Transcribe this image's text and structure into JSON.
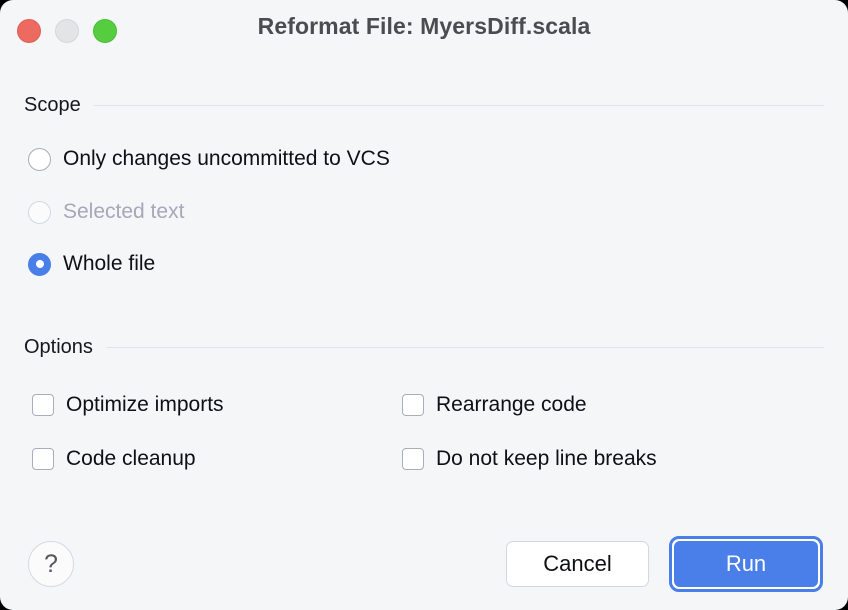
{
  "window": {
    "title": "Reformat File: MyersDiff.scala",
    "background_color": "#f5f6f8",
    "accent_color": "#4a7ee8",
    "traffic_lights": [
      {
        "name": "close",
        "color": "#ec6a5f"
      },
      {
        "name": "minimize",
        "color": "#e3e4e6"
      },
      {
        "name": "zoom",
        "color": "#56cc3f"
      }
    ]
  },
  "scope": {
    "heading": "Scope",
    "options": [
      {
        "label": "Only changes uncommitted to VCS",
        "selected": false,
        "disabled": false
      },
      {
        "label": "Selected text",
        "selected": false,
        "disabled": true
      },
      {
        "label": "Whole file",
        "selected": true,
        "disabled": false
      }
    ]
  },
  "options": {
    "heading": "Options",
    "checkboxes": [
      {
        "label": "Optimize imports",
        "checked": false
      },
      {
        "label": "Rearrange code",
        "checked": false
      },
      {
        "label": "Code cleanup",
        "checked": false
      },
      {
        "label": "Do not keep line breaks",
        "checked": false
      }
    ]
  },
  "footer": {
    "help_label": "?",
    "cancel_label": "Cancel",
    "run_label": "Run"
  }
}
